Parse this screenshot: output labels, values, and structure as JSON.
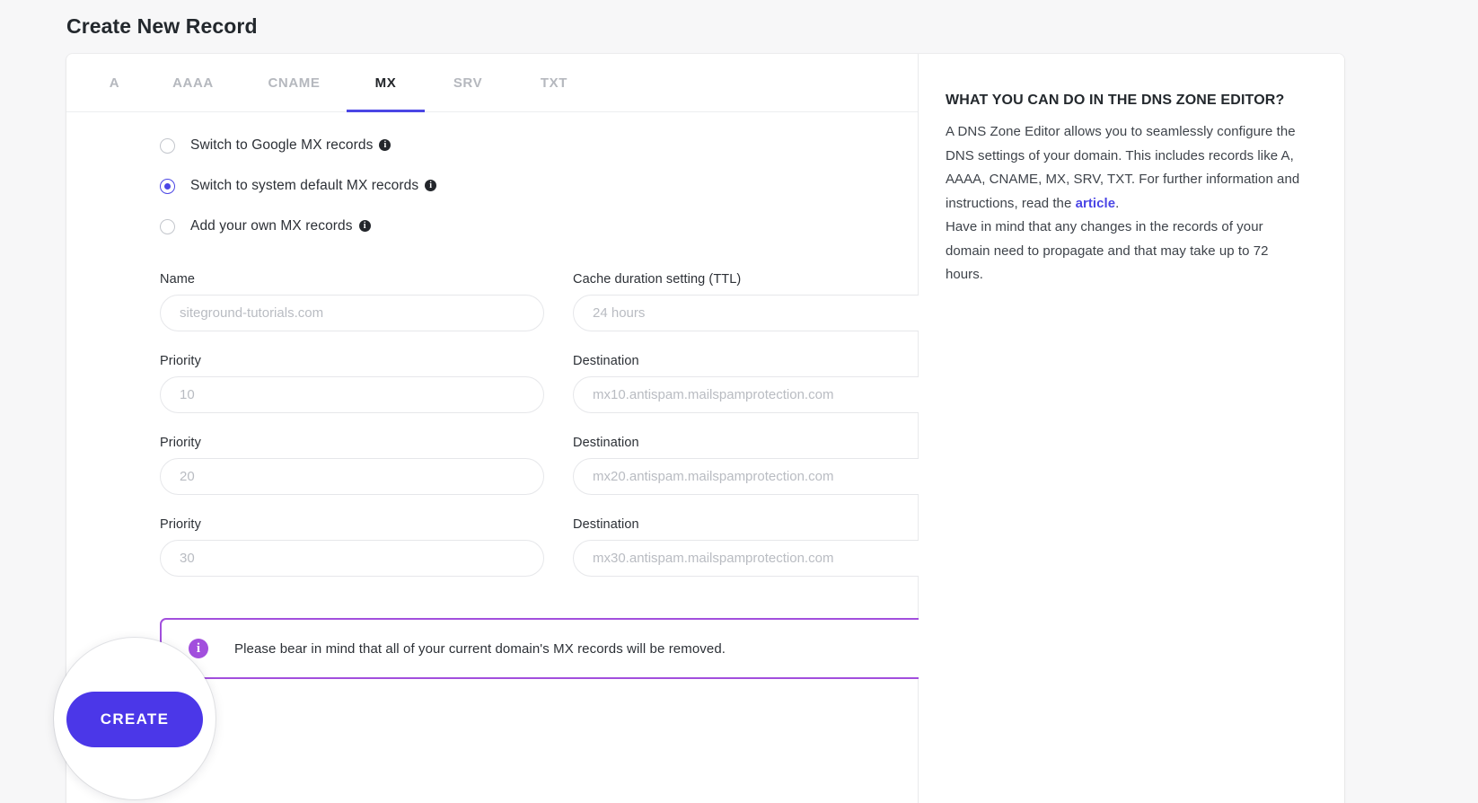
{
  "page": {
    "title": "Create New Record"
  },
  "tabs": [
    {
      "label": "A",
      "active": false
    },
    {
      "label": "AAAA",
      "active": false
    },
    {
      "label": "CNAME",
      "active": false
    },
    {
      "label": "MX",
      "active": true
    },
    {
      "label": "SRV",
      "active": false
    },
    {
      "label": "TXT",
      "active": false
    }
  ],
  "radio_options": [
    {
      "label": "Switch to Google MX records",
      "checked": false,
      "info": "info-icon"
    },
    {
      "label": "Switch to system default MX records",
      "checked": true,
      "info": "info-icon"
    },
    {
      "label": "Add your own MX records",
      "checked": false,
      "info": "info-icon"
    }
  ],
  "form": {
    "name": {
      "label": "Name",
      "value": "",
      "placeholder": "siteground-tutorials.com"
    },
    "ttl": {
      "label": "Cache duration setting (TTL)",
      "value": "",
      "placeholder": "24 hours",
      "chevron": "chevron-down-icon"
    },
    "rows": [
      {
        "priority_label": "Priority",
        "priority_value": "",
        "priority_placeholder": "10",
        "destination_label": "Destination",
        "destination_value": "",
        "destination_placeholder": "mx10.antispam.mailspamprotection.com"
      },
      {
        "priority_label": "Priority",
        "priority_value": "",
        "priority_placeholder": "20",
        "destination_label": "Destination",
        "destination_value": "",
        "destination_placeholder": "mx20.antispam.mailspamprotection.com"
      },
      {
        "priority_label": "Priority",
        "priority_value": "",
        "priority_placeholder": "30",
        "destination_label": "Destination",
        "destination_value": "",
        "destination_placeholder": "mx30.antispam.mailspamprotection.com"
      }
    ]
  },
  "alert": {
    "icon": "info-icon",
    "icon_glyph": "i",
    "text": "Please bear in mind that all of your current domain's MX records will be removed."
  },
  "create_button": {
    "label": "CREATE"
  },
  "info_panel": {
    "title": "WHAT YOU CAN DO IN THE DNS ZONE EDITOR?",
    "paragraph_1_part_1": "A DNS Zone Editor allows you to seamlessly configure the DNS settings of your domain. This includes records like A, AAAA, CNAME, MX, SRV, TXT. For further information and instructions, read the ",
    "link_label": "article",
    "paragraph_1_part_2": ".",
    "paragraph_2": "Have in mind that any changes in the records of your domain need to propagate and that may take up to 72 hours."
  },
  "colors": {
    "accent": "#4b46e5",
    "button": "#4b37e8",
    "alert_border": "#a24fdd",
    "page_background": "#f7f7f8",
    "card_background": "#ffffff",
    "text_primary": "#2c3036",
    "text_muted": "#b5b8be"
  }
}
